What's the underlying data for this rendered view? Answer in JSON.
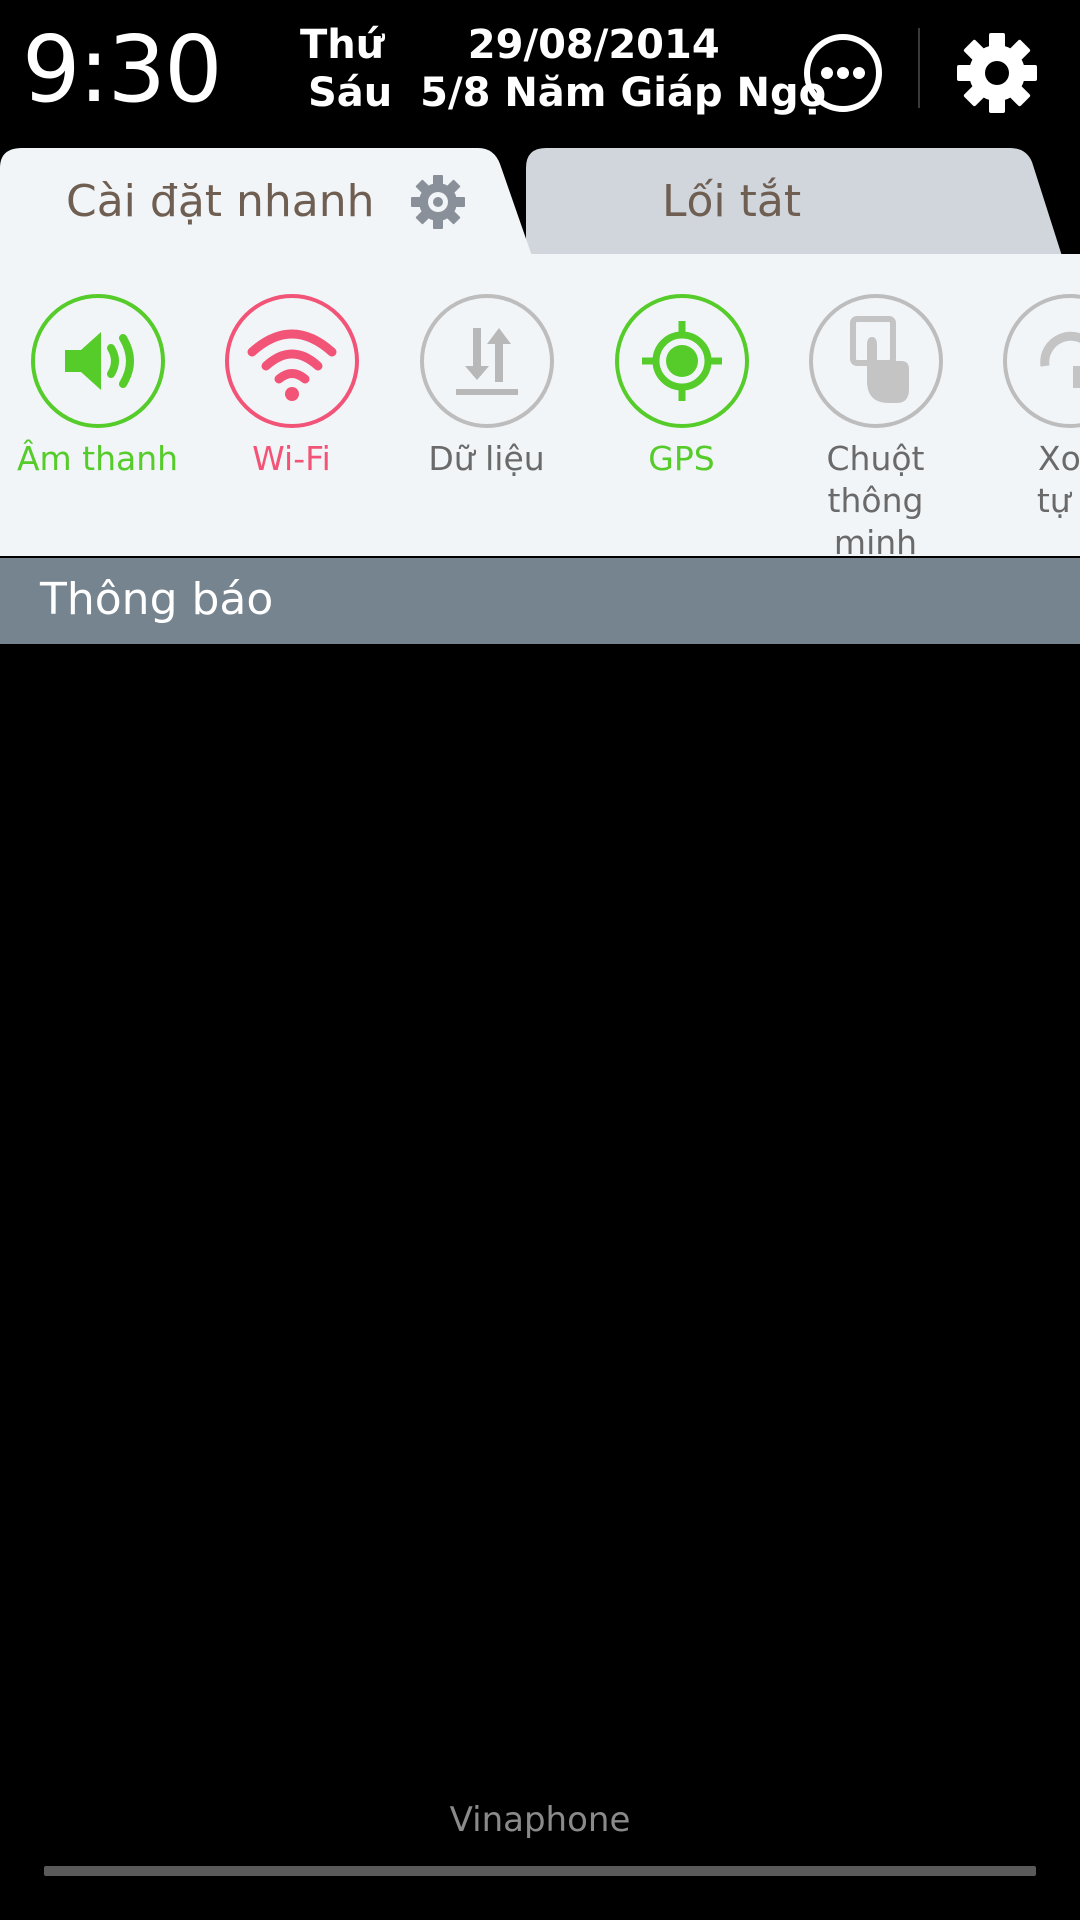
{
  "status": {
    "time": "9:30",
    "date_line1": "Thứ      29/08/2014",
    "date_line2": "Sáu  5/8 Năm Giáp Ngọ"
  },
  "tabs": {
    "quick_settings": "Cài đặt nhanh",
    "shortcuts": "Lối tắt"
  },
  "quick_tiles": [
    {
      "label": "Âm thanh",
      "state": "on",
      "icon": "speaker-icon"
    },
    {
      "label": "Wi-Fi",
      "state": "on",
      "icon": "wifi-icon"
    },
    {
      "label": "Dữ liệu",
      "state": "off",
      "icon": "data-transfer-icon"
    },
    {
      "label": "GPS",
      "state": "on",
      "icon": "gps-icon"
    },
    {
      "label": "Chuột thông\nminh",
      "state": "off",
      "icon": "smart-mouse-icon"
    },
    {
      "label": "Xoa\ntự đ",
      "state": "off",
      "icon": "rotate-icon"
    }
  ],
  "notifications": {
    "title": "Thông báo"
  },
  "footer": {
    "carrier": "Vinaphone"
  },
  "colors": {
    "active_green": "#55cc2a",
    "wifi_red": "#f25478",
    "inactive_gray": "#bdbdbd",
    "notification_bar": "#768490"
  }
}
